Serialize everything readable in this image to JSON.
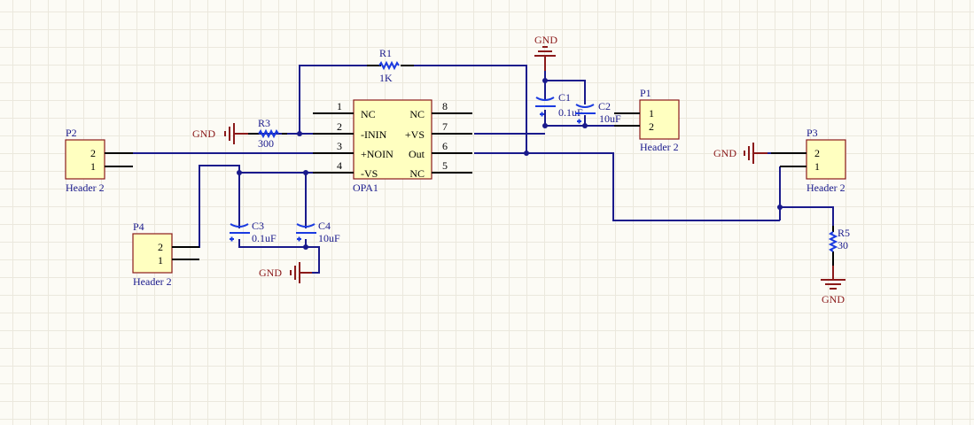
{
  "colors": {
    "wire": "#1a1a8c",
    "component_body": "#ffffc0",
    "component_border": "#8b1a1a",
    "power_port": "#8b1a1a",
    "resistor": "#1a3ae0",
    "background": "#fcfbf5"
  },
  "opamp": {
    "designator": "OPA1",
    "pins": [
      {
        "num": "1",
        "name": "NC"
      },
      {
        "num": "2",
        "name": "-ININ"
      },
      {
        "num": "3",
        "name": "+NOIN"
      },
      {
        "num": "4",
        "name": "-VS"
      },
      {
        "num": "8",
        "name": "NC"
      },
      {
        "num": "7",
        "name": "+VS"
      },
      {
        "num": "6",
        "name": "Out"
      },
      {
        "num": "5",
        "name": "NC"
      }
    ]
  },
  "resistors": [
    {
      "designator": "R1",
      "value": "1K"
    },
    {
      "designator": "R3",
      "value": "300"
    },
    {
      "designator": "R5",
      "value": "30"
    }
  ],
  "capacitors": [
    {
      "designator": "C1",
      "value": "0.1uF"
    },
    {
      "designator": "C2",
      "value": "10uF"
    },
    {
      "designator": "C3",
      "value": "0.1uF"
    },
    {
      "designator": "C4",
      "value": "10uF"
    }
  ],
  "headers": [
    {
      "designator": "P1",
      "comment": "Header 2",
      "pins": [
        "1",
        "2"
      ]
    },
    {
      "designator": "P2",
      "comment": "Header 2",
      "pins": [
        "2",
        "1"
      ]
    },
    {
      "designator": "P3",
      "comment": "Header 2",
      "pins": [
        "2",
        "1"
      ]
    },
    {
      "designator": "P4",
      "comment": "Header 2",
      "pins": [
        "2",
        "1"
      ]
    }
  ],
  "power_ports": {
    "gnd": "GND"
  }
}
